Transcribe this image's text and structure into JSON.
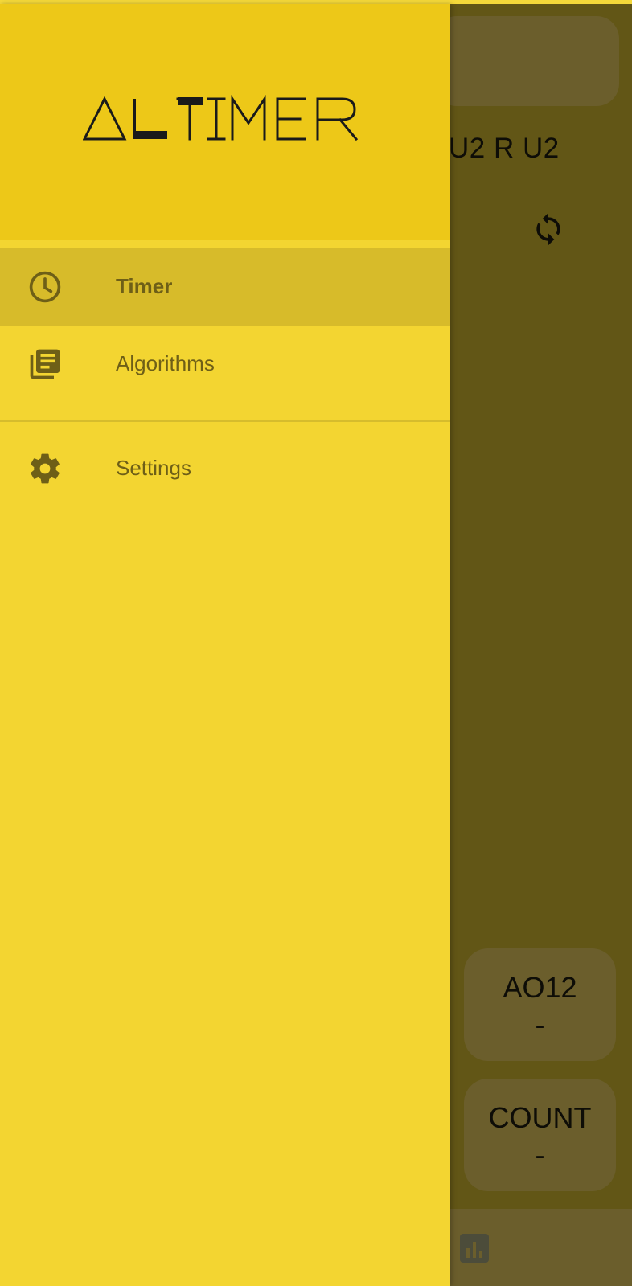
{
  "background": {
    "scramble_text": "U2 R U2",
    "stats": [
      {
        "label": "AO12",
        "value": "-"
      },
      {
        "label": "COUNT",
        "value": "-"
      }
    ],
    "refresh_icon": "refresh-icon",
    "stats_icon": "bar-chart-icon"
  },
  "drawer": {
    "logo_text": "ALTIMER",
    "items": [
      {
        "label": "Timer",
        "icon": "clock-icon",
        "active": true
      },
      {
        "label": "Algorithms",
        "icon": "library-books-icon",
        "active": false
      },
      {
        "label": "Settings",
        "icon": "gear-icon",
        "active": false
      }
    ]
  },
  "colors": {
    "drawer_bg": "#f3d531",
    "header_bg": "#edc818",
    "active_item_bg": "#d7bb2a",
    "label_text": "#6e5f17",
    "scrim": "#625616"
  }
}
